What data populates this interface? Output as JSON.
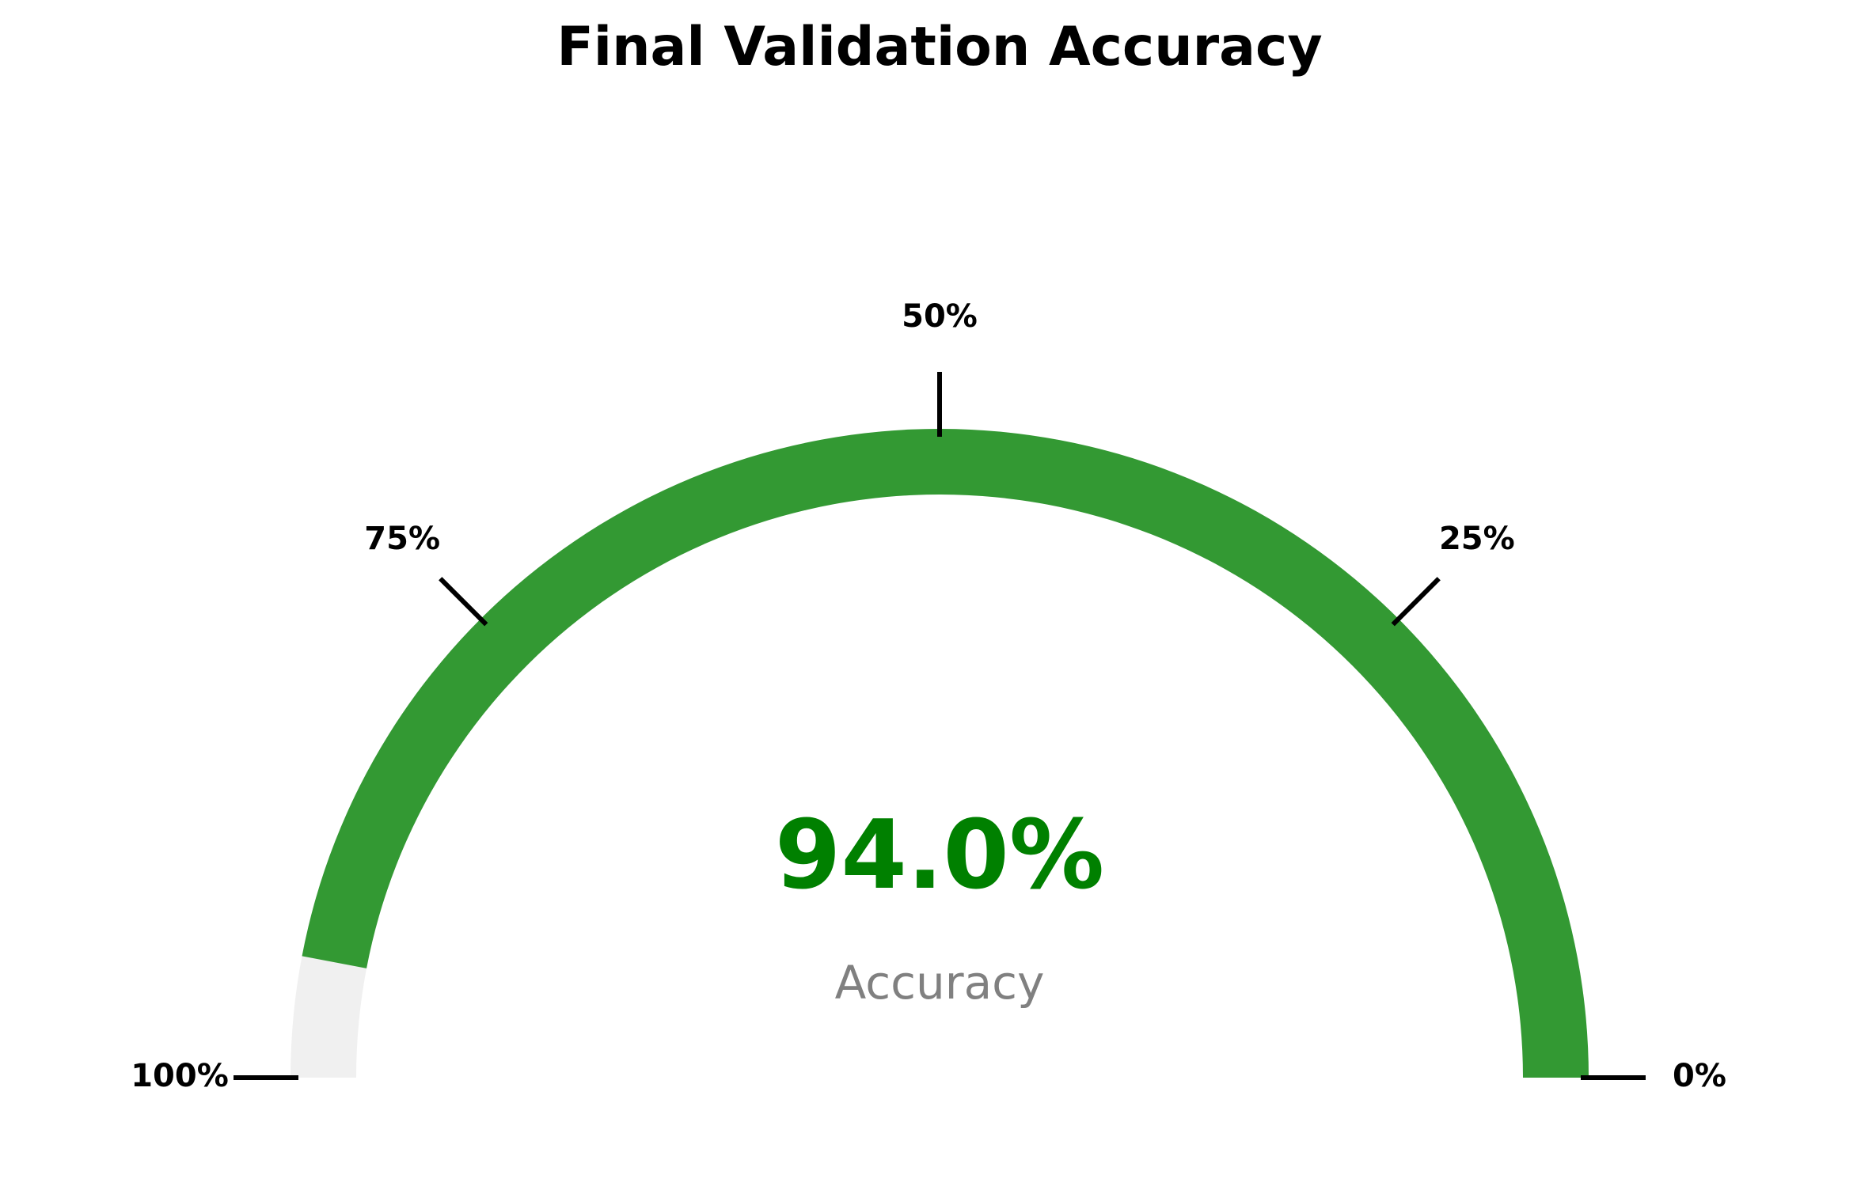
{
  "chart_data": {
    "type": "gauge",
    "title": "Final Validation Accuracy",
    "value": 94.0,
    "value_label": "94.0%",
    "caption": "Accuracy",
    "range": [
      0,
      100
    ],
    "direction": "0% at right, 100% at left",
    "ticks": [
      {
        "value": 0,
        "label": "0%"
      },
      {
        "value": 25,
        "label": "25%"
      },
      {
        "value": 50,
        "label": "50%"
      },
      {
        "value": 75,
        "label": "75%"
      },
      {
        "value": 100,
        "label": "100%"
      }
    ],
    "colors": {
      "fill": "#339933",
      "track": "#f0f0f0",
      "value_text": "#008000",
      "caption_text": "#808080",
      "tick": "#000000"
    }
  }
}
